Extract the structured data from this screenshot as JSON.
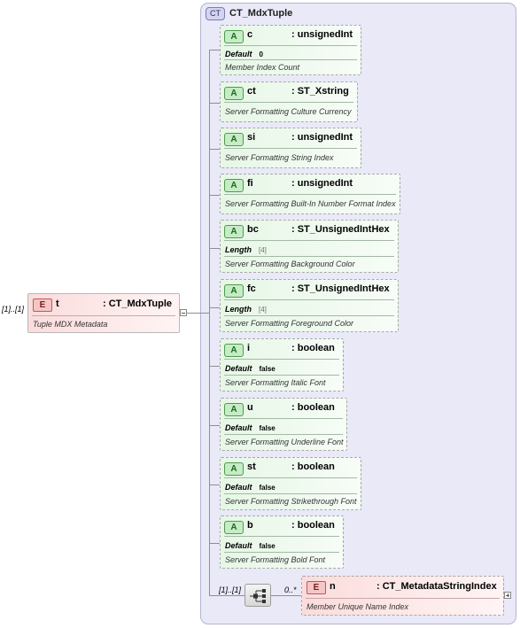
{
  "complex_type": {
    "badge": "CT",
    "name": "CT_MdxTuple"
  },
  "root_element": {
    "cardinality": "[1]..[1]",
    "badge": "E",
    "name": "t",
    "type": ": CT_MdxTuple",
    "doc": "Tuple MDX Metadata"
  },
  "attributes": [
    {
      "badge": "A",
      "name": "c",
      "type": ": unsignedInt",
      "prop_label": "Default",
      "prop_value": "0",
      "doc": "Member Index Count"
    },
    {
      "badge": "A",
      "name": "ct",
      "type": ": ST_Xstring",
      "prop_label": "",
      "prop_value": "",
      "doc": "Server Formatting Culture Currency"
    },
    {
      "badge": "A",
      "name": "si",
      "type": ": unsignedInt",
      "prop_label": "",
      "prop_value": "",
      "doc": "Server Formatting String Index"
    },
    {
      "badge": "A",
      "name": "fi",
      "type": ": unsignedInt",
      "prop_label": "",
      "prop_value": "",
      "doc": "Server Formatting Built-In Number Format Index"
    },
    {
      "badge": "A",
      "name": "bc",
      "type": ": ST_UnsignedIntHex",
      "prop_label": "Length",
      "prop_value": "[4]",
      "doc": "Server Formatting Background Color"
    },
    {
      "badge": "A",
      "name": "fc",
      "type": ": ST_UnsignedIntHex",
      "prop_label": "Length",
      "prop_value": "[4]",
      "doc": "Server Formatting Foreground Color"
    },
    {
      "badge": "A",
      "name": "i",
      "type": ": boolean",
      "prop_label": "Default",
      "prop_value": "false",
      "doc": "Server Formatting Italic Font"
    },
    {
      "badge": "A",
      "name": "u",
      "type": ": boolean",
      "prop_label": "Default",
      "prop_value": "false",
      "doc": "Server Formatting Underline Font"
    },
    {
      "badge": "A",
      "name": "st",
      "type": ": boolean",
      "prop_label": "Default",
      "prop_value": "false",
      "doc": "Server Formatting Strikethrough Font"
    },
    {
      "badge": "A",
      "name": "b",
      "type": ": boolean",
      "prop_label": "Default",
      "prop_value": "false",
      "doc": "Server Formatting Bold Font"
    }
  ],
  "sequence": {
    "cardinality": "[1]..[1]"
  },
  "child_element": {
    "cardinality": "0..*",
    "badge": "E",
    "name": "n",
    "type": ": CT_MetadataStringIndex",
    "doc": "Member Unique Name Index"
  }
}
